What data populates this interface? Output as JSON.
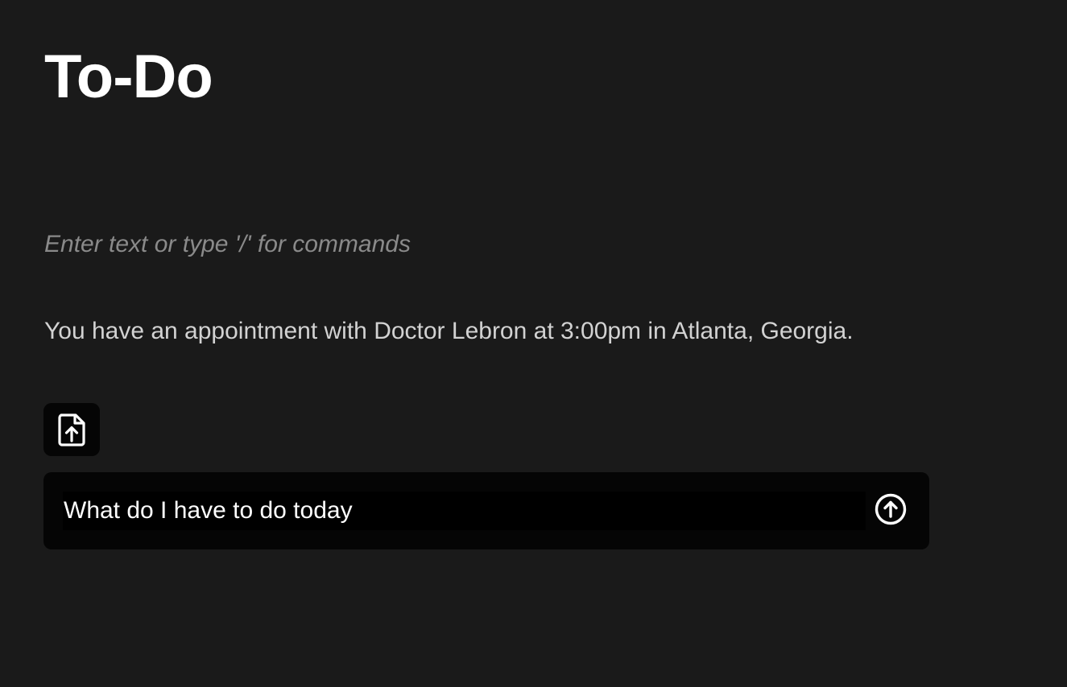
{
  "page": {
    "title": "To-Do"
  },
  "editor": {
    "placeholder": "Enter text or type '/' for commands",
    "response_text": "You have an appointment with Doctor Lebron at 3:00pm in Atlanta, Georgia."
  },
  "toolbar": {
    "upload_icon": "file-upload-icon"
  },
  "chat": {
    "input_value": "What do I have to do today",
    "input_placeholder": "",
    "send_icon": "arrow-up-circle-icon"
  },
  "colors": {
    "background": "#1a1a1a",
    "panel": "#050505",
    "input": "#000000",
    "text_primary": "#ffffff",
    "text_secondary": "#d2d2d2",
    "text_placeholder": "#8a8a8a"
  }
}
